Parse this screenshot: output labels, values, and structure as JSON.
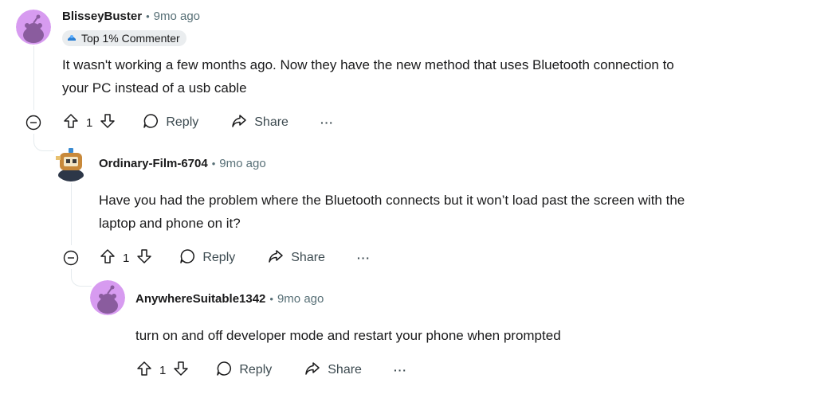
{
  "comments": [
    {
      "author": "BlisseyBuster",
      "time": "9mo ago",
      "badge": "Top 1% Commenter",
      "body_line1": "It wasn't working a few months ago. Now they have the new method that uses Bluetooth connection to",
      "body_line2": "your PC instead of a usb cable",
      "votes": "1",
      "reply_label": "Reply",
      "share_label": "Share",
      "more_label": "···"
    },
    {
      "author": "Ordinary-Film-6704",
      "time": "9mo ago",
      "body_line1": "Have you had the problem where the Bluetooth connects but it won’t load past the screen with the",
      "body_line2": "laptop and phone on it?",
      "votes": "1",
      "reply_label": "Reply",
      "share_label": "Share",
      "more_label": "···"
    },
    {
      "author": "AnywhereSuitable1342",
      "time": "9mo ago",
      "body_line1": "turn on and off developer mode and restart your phone when prompted",
      "votes": "1",
      "reply_label": "Reply",
      "share_label": "Share",
      "more_label": "···"
    }
  ],
  "separator": "•",
  "colors": {
    "avatar_bg": "#d79bf0",
    "muted": "#576f76",
    "thread": "#e5ebee"
  }
}
